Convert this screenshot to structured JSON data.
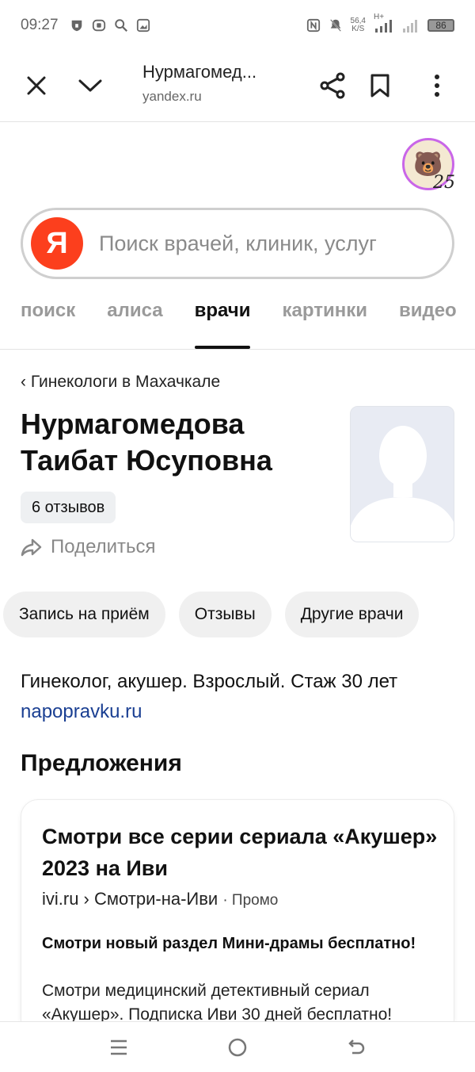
{
  "status_bar": {
    "time": "09:27",
    "net_speed_value": "56,4",
    "net_speed_unit": "K/S",
    "network_type": "H+",
    "battery": "86"
  },
  "browser": {
    "page_title": "Нурмагомед...",
    "host": "yandex.ru"
  },
  "avatar": {
    "badge": "25",
    "emoji": "🐻"
  },
  "search": {
    "logo_letter": "Я",
    "placeholder": "Поиск врачей, клиник, услуг"
  },
  "tabs": [
    "поиск",
    "алиса",
    "врачи",
    "картинки",
    "видео"
  ],
  "active_tab": "врачи",
  "doctor": {
    "breadcrumb": "Гинекологи в Махачкале",
    "name": "Нурмагомедова Таибат Юсуповна",
    "reviews": "6 отзывов",
    "share": "Поделиться",
    "actions": [
      "Запись на приём",
      "Отзывы",
      "Другие врачи"
    ],
    "description": "Гинеколог, акушер. Взрослый. Стаж 30 лет",
    "source": "napopravku.ru"
  },
  "offers": {
    "title": "Предложения",
    "card": {
      "title": "Смотри все серии сериала «Акушер» 2023 на Иви",
      "url": "ivi.ru › Смотри-на-Иви",
      "promo": "· Промо",
      "bold_text": "Смотри новый раздел Мини-драмы бесплатно!",
      "text": "Смотри медицинский детективный сериал «Акушер». Подписка Иви 30 дней бесплатно!"
    }
  },
  "colors": {
    "yandex_red": "#fc3f1d",
    "link_blue": "#1a3f92",
    "avatar_ring": "#c966e8"
  }
}
